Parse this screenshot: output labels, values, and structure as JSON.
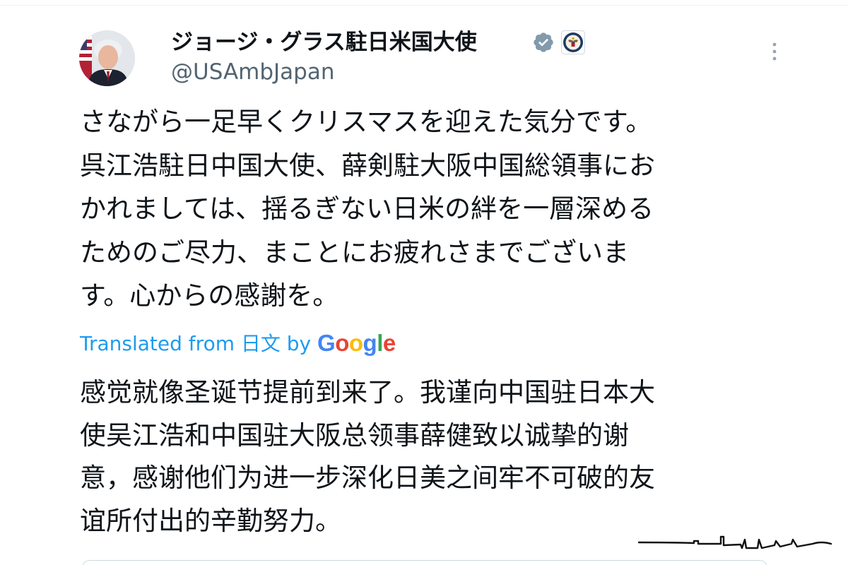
{
  "tweet": {
    "author": {
      "display_name": "ジョージ・グラス駐日米国大使",
      "handle": "@USAmbJapan",
      "verified": true,
      "affiliation_badge": "us-state-department-seal-icon",
      "avatar": "ambassador-portrait-avatar"
    },
    "more_icon": "more-vertical-icon",
    "text": "さながら一足早くクリスマスを迎えた気分です。\n呉江浩駐日中国大使、薛剣駐大阪中国総領事にお\nかれましては、揺るぎない日米の絆を一層深める\nためのご尽力、まことにお疲れさまでございま\nす。心からの感謝を。",
    "translation": {
      "label": "Translated from 日文 by",
      "google_g1": "G",
      "google_o1": "o",
      "google_o2": "o",
      "google_g2": "g",
      "google_l": "l",
      "google_e": "e",
      "text": "感觉就像圣诞节提前到来了。我谨向中国驻日本大\n使吴江浩和中国驻大阪总领事薛健致以诚挚的谢\n意，感谢他们为进一步深化日美之间牢不可破的友\n谊所付出的辛勤努力。"
    }
  },
  "colors": {
    "text_primary": "#0f1419",
    "text_secondary": "#536471",
    "link": "#1d9bf0",
    "verified": "#829aab",
    "divider": "#eff3f4"
  }
}
